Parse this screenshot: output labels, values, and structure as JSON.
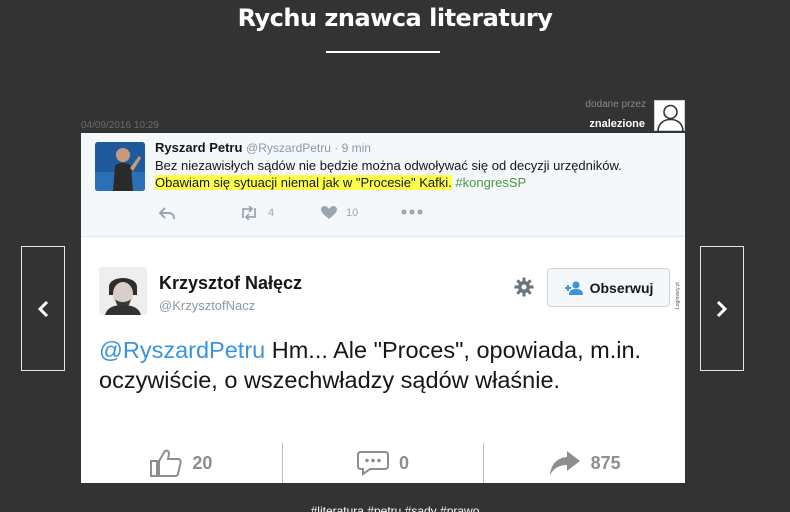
{
  "page": {
    "title": "Rychu znawca literatury"
  },
  "meta": {
    "added_by_label": "dodane przez",
    "author": "znalezione",
    "date": "04/09/2016 10:29"
  },
  "tweet1": {
    "name": "Ryszard Petru",
    "handle_time": "@RyszardPetru · 9 min",
    "text_plain": "Bez niezawisłych sądów nie będzie można odwoływać się od decyzji urzędników.",
    "text_highlight": "Obawiam się sytuacji niemal jak w \"Procesie\" Kafki.",
    "hashtag": "#kongresSP",
    "retweets": "4",
    "likes": "10"
  },
  "tweet2": {
    "name": "Krzysztof Nałęcz",
    "handle": "@KrzysztofNacz",
    "follow_label": "Obserwuj",
    "watermark": "Loginsory.pl",
    "mention": "@RyszardPetru",
    "text": " Hm... Ale \"Proces\", opowiada, m.in. oczywiście, o wszechwładzy sądów właśnie."
  },
  "stats": {
    "likes": "20",
    "comments": "0",
    "shares": "875"
  },
  "tags": "#literatura #petru #sady #prawo",
  "colors": {
    "background": "#333333",
    "highlight": "#ffff4a",
    "mention": "#3b94d9",
    "hashtag": "#4a9a43"
  }
}
